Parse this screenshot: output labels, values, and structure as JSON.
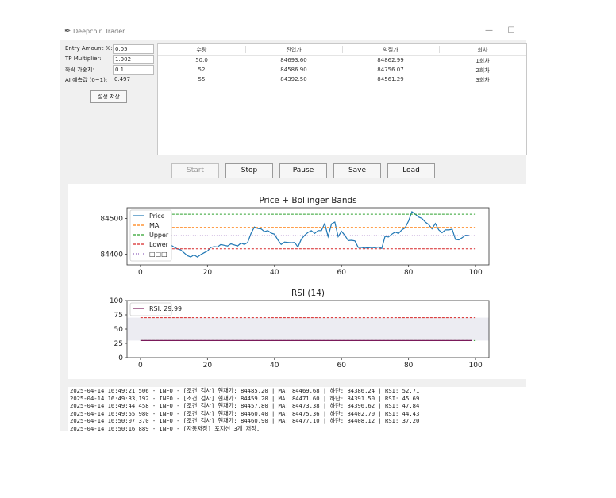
{
  "window": {
    "title": "Deepcoin Trader",
    "minimize_glyph": "—",
    "maximize_glyph": "☐"
  },
  "settings": {
    "entry_label": "Entry Amount %:",
    "entry_value": "0.05",
    "tp_label": "TP Multiplier:",
    "tp_value": "1.002",
    "drop_label": "하락 가중치:",
    "drop_value": "0.1",
    "ai_label": "AI 예측값 (0~1):",
    "ai_value": "0.497",
    "save_label": "설정 저장"
  },
  "table": {
    "headers": [
      "수량",
      "진입가",
      "익절가",
      "회차"
    ],
    "rows": [
      [
        "50.0",
        "84693.60",
        "84862.99",
        "1회차"
      ],
      [
        "52",
        "84586.90",
        "84756.07",
        "2회차"
      ],
      [
        "55",
        "84392.50",
        "84561.29",
        "3회차"
      ]
    ]
  },
  "controls": {
    "start": "Start",
    "stop": "Stop",
    "pause": "Pause",
    "save": "Save",
    "load": "Load"
  },
  "chart_data": [
    {
      "type": "line",
      "title": "Price + Bollinger Bands",
      "xlim": [
        -4,
        104
      ],
      "ylim": [
        84370,
        84530
      ],
      "xticks": [
        0,
        20,
        40,
        60,
        80,
        100
      ],
      "yticks": [
        84400,
        84500
      ],
      "legend_position": "top-left",
      "series": [
        {
          "name": "Price",
          "color": "#1f77b4",
          "style": "solid",
          "x": [
            0,
            1,
            2,
            3,
            4,
            5,
            6,
            7,
            8,
            9,
            10,
            11,
            12,
            13,
            14,
            15,
            16,
            17,
            18,
            19,
            20,
            21,
            22,
            23,
            24,
            25,
            26,
            27,
            28,
            29,
            30,
            31,
            32,
            33,
            34,
            35,
            36,
            37,
            38,
            39,
            40,
            41,
            42,
            43,
            44,
            45,
            46,
            47,
            48,
            49,
            50,
            51,
            52,
            53,
            54,
            55,
            56,
            57,
            58,
            59,
            60,
            61,
            62,
            63,
            64,
            65,
            66,
            67,
            68,
            69,
            70,
            71,
            72,
            73,
            74,
            75,
            76,
            77,
            78,
            79,
            80,
            81,
            82,
            83,
            84,
            85,
            86,
            87,
            88,
            89,
            90,
            91,
            92,
            93,
            94,
            95,
            96,
            97,
            98
          ],
          "y": [
            84500,
            84498,
            84488,
            84476,
            84470,
            84462,
            84452,
            84444,
            84434,
            84426,
            84420,
            84415,
            84412,
            84404,
            84396,
            84392,
            84398,
            84392,
            84399,
            84404,
            84409,
            84419,
            84421,
            84420,
            84427,
            84425,
            84423,
            84429,
            84426,
            84423,
            84431,
            84427,
            84433,
            84458,
            84476,
            84472,
            84471,
            84463,
            84466,
            84459,
            84456,
            84440,
            84427,
            84434,
            84433,
            84432,
            84433,
            84420,
            84442,
            84453,
            84461,
            84466,
            84458,
            84466,
            84466,
            84486,
            84449,
            84485,
            84490,
            84449,
            84464,
            84453,
            84438,
            84439,
            84437,
            84419,
            84419,
            84417,
            84418,
            84419,
            84418,
            84420,
            84416,
            84450,
            84448,
            84456,
            84462,
            84458,
            84468,
            84474,
            84493,
            84519,
            84512,
            84504,
            84500,
            84490,
            84483,
            84471,
            84486,
            84468,
            84460,
            84468,
            84468,
            84470,
            84441,
            84440,
            84446,
            84453,
            84453
          ]
        },
        {
          "name": "MA",
          "color": "#ff7f0e",
          "style": "dashed",
          "x": [
            0,
            100
          ],
          "y": [
            84475,
            84475
          ]
        },
        {
          "name": "Upper",
          "color": "#2ca02c",
          "style": "dashed",
          "x": [
            0,
            100
          ],
          "y": [
            84512,
            84512
          ]
        },
        {
          "name": "Lower",
          "color": "#d62728",
          "style": "dashed",
          "x": [
            0,
            100
          ],
          "y": [
            84415,
            84415
          ]
        },
        {
          "name": "□□□",
          "color": "#9467bd",
          "style": "dotted",
          "x": [
            0,
            100
          ],
          "y": [
            84452,
            84452
          ]
        }
      ]
    },
    {
      "type": "line",
      "title": "RSI (14)",
      "xlim": [
        -4,
        104
      ],
      "ylim": [
        0,
        100
      ],
      "xticks": [
        0,
        20,
        40,
        60,
        80,
        100
      ],
      "yticks": [
        0,
        25,
        50,
        75,
        100
      ],
      "legend_position": "top-left",
      "shaded_band": [
        30,
        70
      ],
      "hlines": [
        {
          "y": 70,
          "color": "#d62728"
        },
        {
          "y": 30,
          "color": "#2ca02c"
        }
      ],
      "series": [
        {
          "name": "RSI: 29.99",
          "color": "#7a1a5a",
          "style": "solid",
          "x": [
            0,
            99
          ],
          "y": [
            29.99,
            29.99
          ]
        }
      ]
    }
  ],
  "log": [
    "2025-04-14 16:49:21,506 - INFO - [조건 검사] 현재가: 84485.20 | MA: 84469.68 | 하단: 84386.24 | RSI: 52.71",
    "2025-04-14 16:49:33,192 - INFO - [조건 검사] 현재가: 84459.20 | MA: 84471.60 | 하단: 84391.50 | RSI: 45.69",
    "2025-04-14 16:49:44,458 - INFO - [조건 검사] 현재가: 84457.80 | MA: 84473.38 | 하단: 84396.62 | RSI: 47.84",
    "2025-04-14 16:49:55,980 - INFO - [조건 검사] 현재가: 84460.40 | MA: 84475.36 | 하단: 84402.70 | RSI: 44.43",
    "2025-04-14 16:50:07,370 - INFO - [조건 검사] 현재가: 84460.90 | MA: 84477.10 | 하단: 84408.12 | RSI: 37.20",
    "2025-04-14 16:50:16,889 - INFO - [자동저장] 포지션 3개 저장."
  ]
}
